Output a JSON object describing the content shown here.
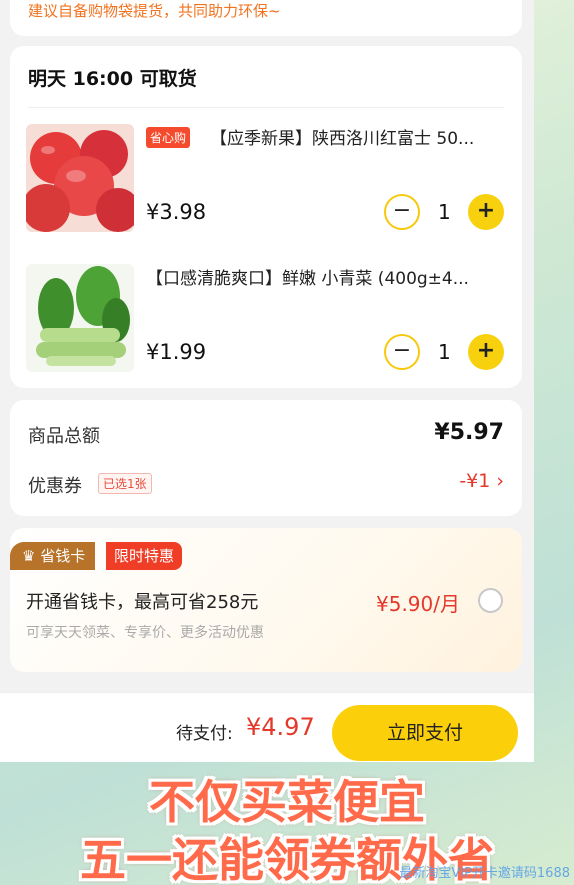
{
  "notice": {
    "text": "建议自备购物袋提货，共同助力环保~"
  },
  "pickup": {
    "title": "明天 16:00 可取货"
  },
  "items": [
    {
      "tag": "省心购",
      "title": "【应季新果】陕西洛川红富士 50...",
      "price": "¥3.98",
      "qty": "1",
      "image": "apples"
    },
    {
      "tag": "",
      "title": "【口感清脆爽口】鲜嫩 小青菜 (400g±4...",
      "price": "¥1.99",
      "qty": "1",
      "image": "bok-choy"
    }
  ],
  "controls": {
    "minus": "−",
    "plus": "+"
  },
  "summary": {
    "total_label": "商品总额",
    "total_value": "¥5.97",
    "coupon_label": "优惠券",
    "coupon_tag": "已选1张",
    "coupon_value": "-¥1 ›"
  },
  "vip": {
    "badge": "省钱卡",
    "badge2": "限时特惠",
    "title": "开通省钱卡，最高可省258元",
    "subtitle": "可享天天领菜、专享价、更多活动优惠",
    "price": "¥5.90/月"
  },
  "checkout": {
    "label": "待支付:",
    "amount": "¥4.97",
    "button": "立即支付"
  },
  "caption": {
    "line1": "不仅买菜便宜",
    "line2": "五一还能领券额外省"
  },
  "watermark": "最新淘宝VIP开卡邀请码1688",
  "colors": {
    "accent": "#fbcf0a",
    "price_red": "#e5382b",
    "notice_orange": "#f2731f"
  }
}
